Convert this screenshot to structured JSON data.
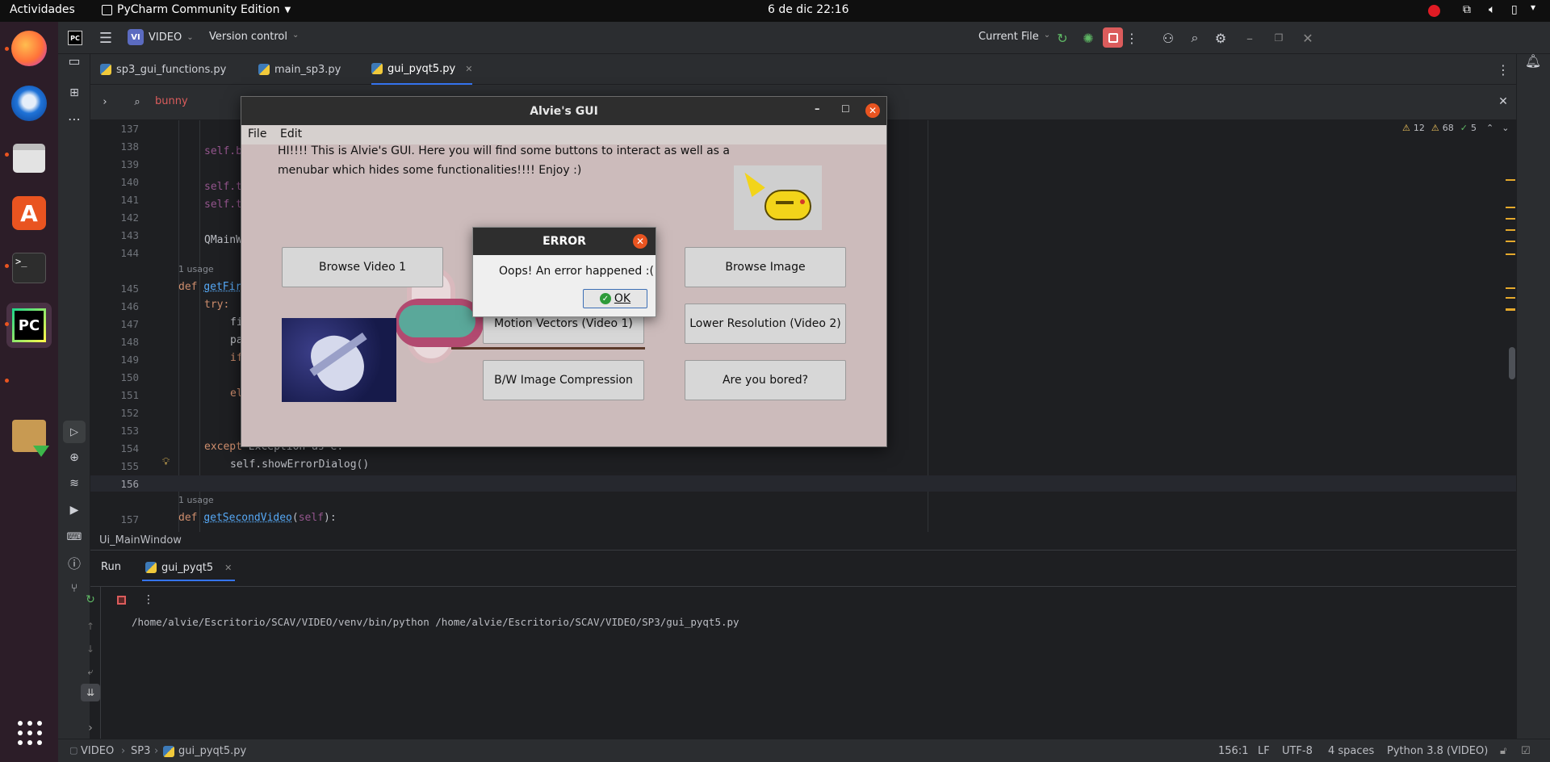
{
  "system": {
    "activities": "Actividades",
    "app_menu": "PyCharm Community Edition",
    "clock": "6 de dic  22:16"
  },
  "ide": {
    "project_badge": "VI",
    "project_name": "VIDEO",
    "vcs": "Version control",
    "run_config": "Current File",
    "tabs": [
      {
        "label": "sp3_gui_functions.py"
      },
      {
        "label": "main_sp3.py"
      },
      {
        "label": "gui_pyqt5.py"
      }
    ],
    "search_query": "bunny",
    "inspections": {
      "warnings": "12",
      "weak": "68",
      "ok": "5"
    },
    "line_numbers": [
      "137",
      "138",
      "139",
      "140",
      "141",
      "142",
      "143",
      "144",
      "145",
      "146",
      "147",
      "148",
      "149",
      "150",
      "151",
      "152",
      "153",
      "154",
      "155",
      "156",
      "157"
    ],
    "code": {
      "l138": "self.b",
      "l140": "self.t",
      "l141": "self.t",
      "l143": "QMainW",
      "usage1": "1 usage",
      "l145_def": "def ",
      "l145_fn": "getFir",
      "l146": "try:",
      "l147": "fi",
      "l148": "pa",
      "l149": "if",
      "l151": "el",
      "l154_kw": "except ",
      "l154_rest": "Exception as e:",
      "l155": "self.showErrorDialog()",
      "usage2": "1 usage",
      "l157_def": "def ",
      "l157_fn": "getSecondVideo",
      "l157_open": "(",
      "l157_self": "self",
      "l157_close": "):"
    },
    "structure_crumb": "Ui_MainWindow",
    "run": {
      "title": "Run",
      "tab": "gui_pyqt5",
      "output": "/home/alvie/Escritorio/SCAV/VIDEO/venv/bin/python /home/alvie/Escritorio/SCAV/VIDEO/SP3/gui_pyqt5.py"
    },
    "status": {
      "path": [
        "VIDEO",
        "SP3",
        "gui_pyqt5.py"
      ],
      "position": "156:1",
      "line_sep": "LF",
      "encoding": "UTF-8",
      "indent": "4 spaces",
      "interpreter": "Python 3.8 (VIDEO)"
    }
  },
  "app": {
    "title": "Alvie's GUI",
    "menu": [
      "File",
      "Edit"
    ],
    "intro_line1": "HI!!!! This is Alvie's GUI. Here you will find some buttons to interact as well as a",
    "intro_line2": "menubar which hides some functionalities!!!! Enjoy :)",
    "buttons": {
      "browse_video": "Browse Video 1",
      "browse_image": "Browse Image",
      "motion_vectors": "Motion Vectors (Video 1)",
      "lower_resolution": "Lower Resolution (Video 2)",
      "bw_compression": "B/W Image Compression",
      "bored": "Are you bored?"
    }
  },
  "dialog": {
    "title": "ERROR",
    "message": "Oops! An error happened :(",
    "ok": "OK"
  },
  "colors": {
    "accent_orange": "#e95420",
    "dock_bg": "#2c1d28",
    "ide_bg": "#1e1f22",
    "app_bg": "#ccbbbb"
  }
}
